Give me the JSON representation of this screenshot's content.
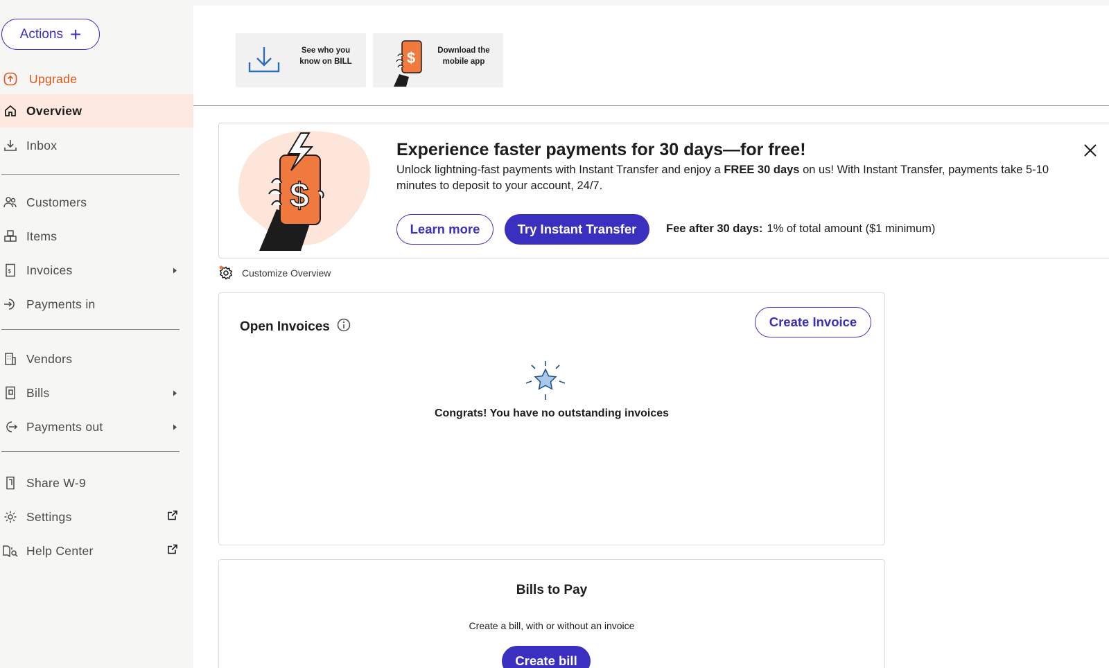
{
  "sidebar": {
    "actions_label": "Actions",
    "upgrade_label": "Upgrade",
    "items": [
      {
        "label": "Overview",
        "icon": "home-icon"
      },
      {
        "label": "Inbox",
        "icon": "inbox-download-icon"
      },
      {
        "label": "Customers",
        "icon": "people-icon"
      },
      {
        "label": "Items",
        "icon": "boxes-icon"
      },
      {
        "label": "Invoices",
        "icon": "invoice-icon"
      },
      {
        "label": "Payments in",
        "icon": "payments-in-icon"
      },
      {
        "label": "Vendors",
        "icon": "building-icon"
      },
      {
        "label": "Bills",
        "icon": "bill-icon"
      },
      {
        "label": "Payments out",
        "icon": "payments-out-icon"
      },
      {
        "label": "Share W-9",
        "icon": "share-doc-icon"
      },
      {
        "label": "Settings",
        "icon": "gear-icon"
      },
      {
        "label": "Help Center",
        "icon": "help-book-icon"
      }
    ]
  },
  "tiles": {
    "see_who": "See who you know on BILL",
    "download_app": "Download the mobile app"
  },
  "promo": {
    "title": "Experience faster payments for 30 days—for free!",
    "desc_1": "Unlock lightning-fast payments with Instant Transfer and enjoy a ",
    "desc_bold": "FREE 30 days",
    "desc_2": " on us! With Instant Transfer, payments take 5-10 minutes to deposit to your account, 24/7.",
    "learn_more": "Learn more",
    "try_transfer": "Try Instant Transfer",
    "fee_label": "Fee after 30 days:",
    "fee_value": "1% of total amount ($1 minimum)"
  },
  "customize_label": "Customize Overview",
  "open_invoices": {
    "title": "Open Invoices",
    "create_label": "Create Invoice",
    "empty_msg": "Congrats! You have no outstanding invoices"
  },
  "bills_to_pay": {
    "title": "Bills to Pay",
    "sub": "Create a bill, with or without an invoice",
    "create_label": "Create bill"
  },
  "colors": {
    "brand": "#3a2fbe",
    "accent_orange": "#f07a3e",
    "active_bg": "#fde9df"
  }
}
